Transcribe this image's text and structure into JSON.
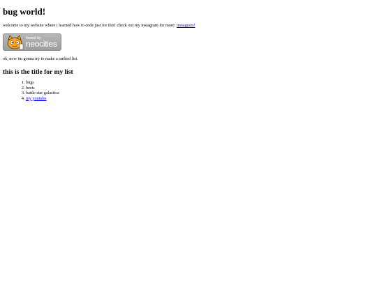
{
  "page": {
    "title": "bug world!",
    "intro_text": "welcome to my website where i learned how to code just for this! check out my instagram for more: ",
    "intro_link": "instagram!",
    "badge": {
      "line1": "hosted by",
      "line2": "neocities"
    },
    "note": "ok, now im gonna try to make a ranked list.",
    "list_title": "this is the title for my list",
    "list_items": [
      "bugs",
      "beets",
      "battle star galactica"
    ],
    "list_link": "my youtube"
  }
}
